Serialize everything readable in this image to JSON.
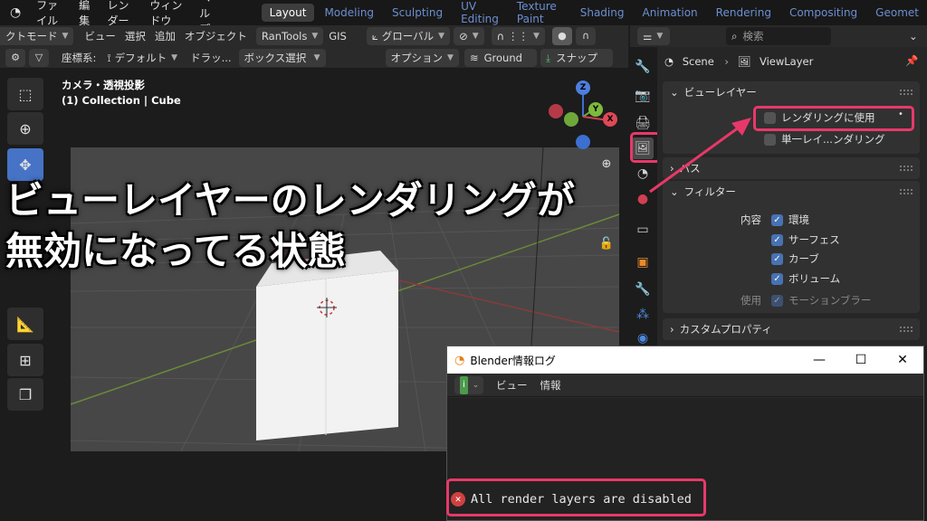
{
  "topbar": {
    "menus": [
      "ファイル",
      "編集",
      "レンダー",
      "ウィンドウ",
      "ヘルプ"
    ],
    "workspaces": [
      "Layout",
      "Modeling",
      "Sculpting",
      "UV Editing",
      "Texture Paint",
      "Shading",
      "Animation",
      "Rendering",
      "Compositing",
      "Geomet"
    ],
    "active_workspace": "Layout"
  },
  "viewport_header": {
    "mode": "クトモード",
    "menus": [
      "ビュー",
      "選択",
      "追加",
      "オブジェクト"
    ],
    "rantools": "RanTools",
    "gis": "GIS",
    "transform_orientation": "グローバル",
    "coord_label": "座標系:",
    "coord_value": "デフォルト",
    "drag_label": "ドラッ...",
    "select_mode": "ボックス選択",
    "options": "オプション",
    "ground": "Ground",
    "snap": "スナップ"
  },
  "viewport": {
    "camera_label": "カメラ・透視投影",
    "collection_label": "(1) Collection | Cube"
  },
  "gizmo": {
    "z": "Z",
    "y": "Y",
    "x": "X"
  },
  "caption": {
    "line1": "ビューレイヤーのレンダリングが",
    "line2": "無効になってる状態"
  },
  "properties": {
    "search_placeholder": "検索",
    "breadcrumb_scene": "Scene",
    "breadcrumb_viewlayer": "ViewLayer",
    "panel_view_layer": "ビューレイヤー",
    "use_for_rendering": "レンダリングに使用",
    "use_for_rendering_checked": false,
    "single_layer": "単一レイ...ンダリング",
    "single_layer_checked": false,
    "panel_passes": "パス",
    "panel_filter": "フィルター",
    "filter_include_label": "内容",
    "filter_items": [
      "環境",
      "サーフェス",
      "カーブ",
      "ボリューム"
    ],
    "filter_use_label": "使用",
    "filter_motion_blur": "モーションブラー",
    "panel_custom_props": "カスタムプロパティ"
  },
  "info_window": {
    "title": "Blender情報ログ",
    "menus": [
      "ビュー",
      "情報"
    ],
    "error_message": "All render layers are disabled"
  },
  "colors": {
    "accent_highlight": "#e8386a",
    "active_blue": "#4673c6",
    "checkbox_blue": "#4772b3"
  }
}
